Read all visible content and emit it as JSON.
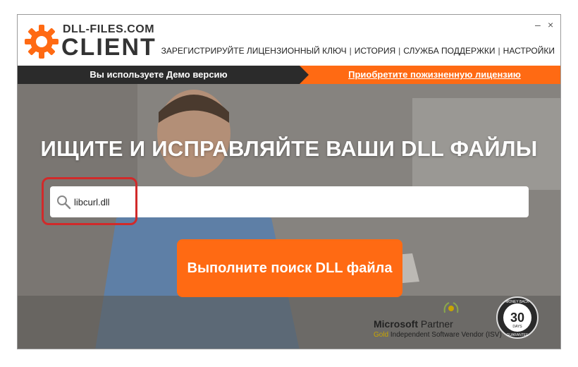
{
  "app": {
    "logo_top": "DLL-FILES.COM",
    "logo_bottom": "CLIENT",
    "minimize": "–",
    "close": "×"
  },
  "nav": {
    "register": "ЗАРЕГИСТРИРУЙТЕ ЛИЦЕНЗИОННЫЙ КЛЮЧ",
    "history": "ИСТОРИЯ",
    "support": "СЛУЖБА ПОДДЕРЖКИ",
    "settings": "НАСТРОЙКИ",
    "separator": "|"
  },
  "banner": {
    "demo": "Вы используете Демо версию",
    "buy": "Приобретите пожизненную лицензию"
  },
  "hero": {
    "headline": "ИЩИТЕ И ИСПРАВЛЯЙТЕ ВАШИ DLL ФАЙЛЫ",
    "search_value": "libcurl.dll",
    "search_button": "Выполните поиск DLL файла"
  },
  "badges": {
    "ms_brand": "Microsoft",
    "ms_partner": "Partner",
    "gold": "Gold",
    "isv": "Independent Software Vendor (ISV)",
    "guarantee_days": "30",
    "guarantee_top": "MONEY BACK",
    "guarantee_bottom": "GUARANTEE",
    "guarantee_unit": "DAYS"
  },
  "colors": {
    "accent": "#ff6a13",
    "dark": "#2b2b2b",
    "highlight": "#d12a2a"
  }
}
